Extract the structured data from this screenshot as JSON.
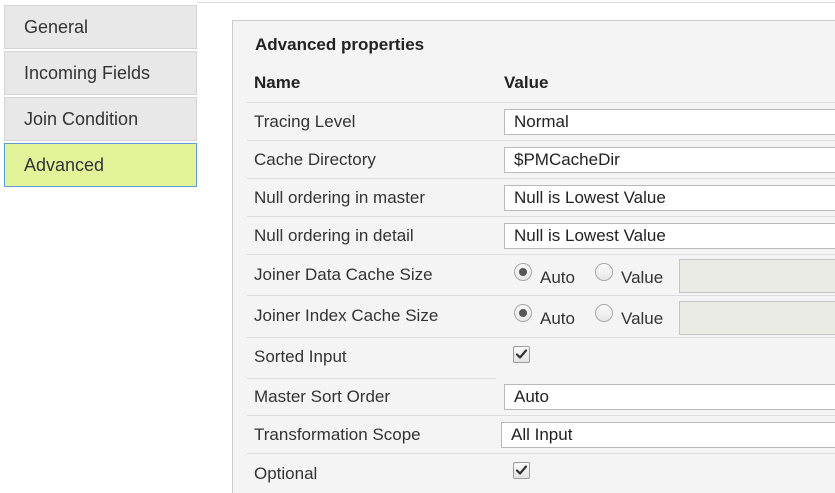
{
  "sidebar": {
    "items": [
      {
        "label": "General"
      },
      {
        "label": "Incoming Fields"
      },
      {
        "label": "Join Condition"
      },
      {
        "label": "Advanced"
      }
    ],
    "active_item": "Advanced"
  },
  "panel": {
    "title": "Advanced properties",
    "columns": {
      "name": "Name",
      "value": "Value"
    },
    "rows": {
      "tracing_level": {
        "label": "Tracing Level",
        "value": "Normal"
      },
      "cache_directory": {
        "label": "Cache Directory",
        "value": "$PMCacheDir"
      },
      "null_ordering_master": {
        "label": "Null ordering in master",
        "value": "Null is Lowest Value"
      },
      "null_ordering_detail": {
        "label": "Null ordering in detail",
        "value": "Null is Lowest Value"
      },
      "joiner_data_cache": {
        "label": "Joiner Data Cache Size",
        "option_auto": "Auto",
        "option_value": "Value",
        "selected": "Auto",
        "value": ""
      },
      "joiner_index_cache": {
        "label": "Joiner Index Cache Size",
        "option_auto": "Auto",
        "option_value": "Value",
        "selected": "Auto",
        "value": ""
      },
      "sorted_input": {
        "label": "Sorted Input",
        "checked": true
      },
      "master_sort_order": {
        "label": "Master Sort Order",
        "value": "Auto"
      },
      "transformation_scope": {
        "label": "Transformation Scope",
        "value": "All Input"
      },
      "optional": {
        "label": "Optional",
        "checked": true
      }
    }
  },
  "colors": {
    "active_tab_bg": "#e2f39a",
    "active_tab_border": "#5f9bd6",
    "tab_bg": "#e8e8e8",
    "panel_bg": "#f4f4f4"
  }
}
